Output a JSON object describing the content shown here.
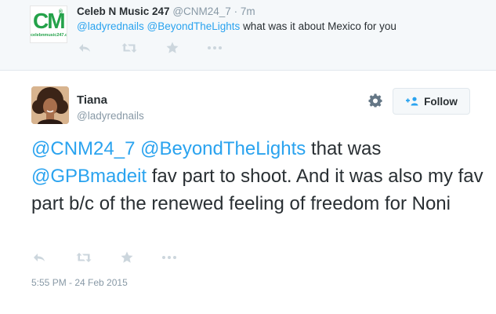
{
  "parent_tweet": {
    "avatar": {
      "logo_text": "CM",
      "logo_tm": "®",
      "logo_site": "celebnmusic247.com"
    },
    "display_name": "Celeb N Music 247",
    "handle": "@CNM24_7",
    "separator": "·",
    "time": "7m",
    "mentions": [
      "@ladyrednails",
      "@BeyondTheLights"
    ],
    "text": "what was it about Mexico for you",
    "actions": [
      "reply-icon",
      "retweet-icon",
      "favorite-icon",
      "more-icon"
    ]
  },
  "main_tweet": {
    "display_name": "Tiana",
    "handle": "@ladyrednails",
    "follow_label": "Follow",
    "text_parts": {
      "mention1": "@CNM24_7",
      "mention2": "@BeyondTheLights",
      "part1": "that was",
      "mention3": "@GPBmadeit",
      "part2": "fav part to shoot. And it was also my fav part b/c of the renewed feeling of freedom for Noni"
    },
    "timestamp": "5:55 PM - 24 Feb 2015",
    "actions": [
      "reply-icon",
      "retweet-icon",
      "favorite-icon",
      "more-icon"
    ]
  },
  "colors": {
    "link": "#2aa3ef",
    "text": "#292f33",
    "muted": "#8899a6",
    "icon": "#ccd6dd",
    "parent_bg": "#f5f8fa",
    "logo_green": "#24a24a"
  }
}
